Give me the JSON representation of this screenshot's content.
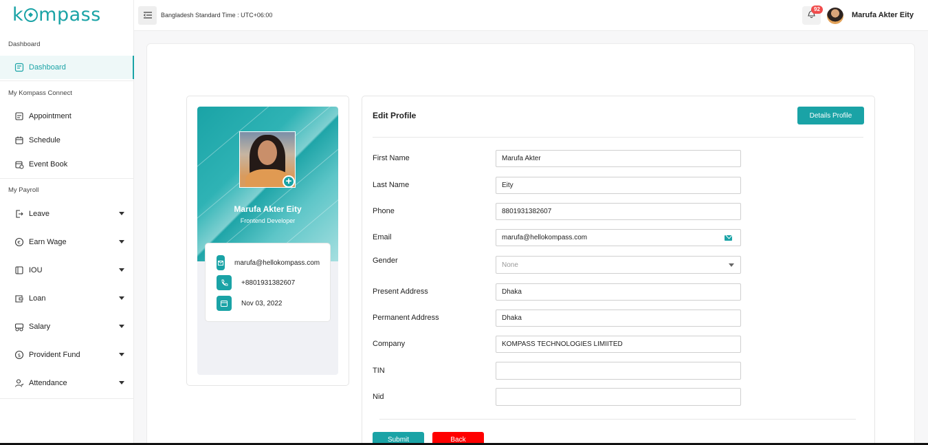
{
  "sidebar": {
    "logo": "kompass",
    "sections": [
      {
        "label": "Dashboard"
      },
      {
        "label": "My Kompass Connect"
      },
      {
        "label": "My Payroll"
      }
    ],
    "items": [
      {
        "label": "Dashboard",
        "icon": "dashboard-icon",
        "active": true
      },
      {
        "label": "Appointment",
        "icon": "appointment-icon"
      },
      {
        "label": "Schedule",
        "icon": "calendar-icon"
      },
      {
        "label": "Event Book",
        "icon": "event-book-icon"
      },
      {
        "label": "Leave",
        "icon": "leave-icon",
        "expandable": true
      },
      {
        "label": "Earn Wage",
        "icon": "earn-wage-icon",
        "expandable": true
      },
      {
        "label": "IOU",
        "icon": "iou-icon",
        "expandable": true
      },
      {
        "label": "Loan",
        "icon": "loan-icon",
        "expandable": true
      },
      {
        "label": "Salary",
        "icon": "salary-icon",
        "expandable": true
      },
      {
        "label": "Provident Fund",
        "icon": "provident-fund-icon",
        "expandable": true
      },
      {
        "label": "Attendance",
        "icon": "attendance-icon",
        "expandable": true
      }
    ]
  },
  "header": {
    "timezone": "Bangladesh Standard Time : UTC+06:00",
    "notification_count": "92",
    "user_name": "Marufa Akter Eity"
  },
  "profile": {
    "name": "Marufa Akter Eity",
    "role": "Frontend Developer",
    "email": "marufa@hellokompass.com",
    "phone": "+8801931382607",
    "date": "Nov 03, 2022"
  },
  "form": {
    "title": "Edit Profile",
    "details_button": "Details Profile",
    "fields": [
      {
        "label": "First Name",
        "value": "Marufa Akter"
      },
      {
        "label": "Last Name",
        "value": "Eity"
      },
      {
        "label": "Phone",
        "value": "8801931382607"
      },
      {
        "label": "Email",
        "value": "marufa@hellokompass.com"
      },
      {
        "label": "Gender",
        "value": "None"
      },
      {
        "label": "Present Address",
        "value": "Dhaka"
      },
      {
        "label": "Permanent Address",
        "value": "Dhaka"
      },
      {
        "label": "Company",
        "value": "KOMPASS TECHNOLOGIES LIMIITED"
      },
      {
        "label": "TIN",
        "value": ""
      },
      {
        "label": "Nid",
        "value": ""
      }
    ],
    "submit_label": "Submit",
    "back_label": "Back"
  },
  "colors": {
    "accent": "#1aa3a6",
    "danger": "#ff0000",
    "badge": "#f04b4b"
  }
}
